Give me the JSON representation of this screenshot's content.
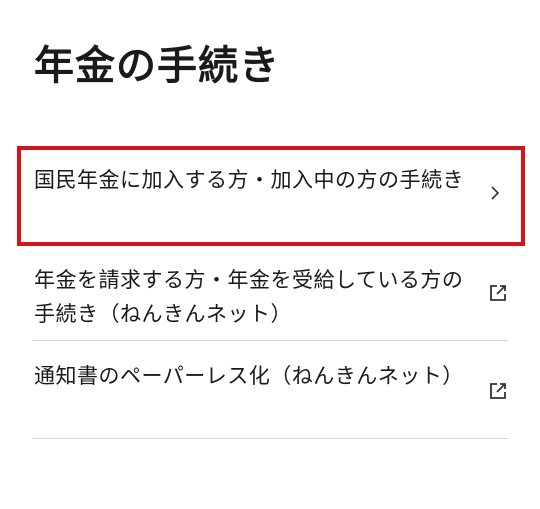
{
  "page": {
    "title": "年金の手続き"
  },
  "links": [
    {
      "label": "国民年金に加入する方・加入中の方の手続き",
      "icon": "chevron-right-icon",
      "highlighted": true
    },
    {
      "label": "年金を請求する方・年金を受給している方の手続き（ねんきんネット）",
      "icon": "external-link-icon",
      "highlighted": false
    },
    {
      "label": "通知書のペーパーレス化（ねんきんネット）",
      "icon": "external-link-icon",
      "highlighted": false
    }
  ],
  "colors": {
    "highlight": "#d4161c",
    "divider": "#d6d6d6",
    "text": "#1a1a1a"
  }
}
